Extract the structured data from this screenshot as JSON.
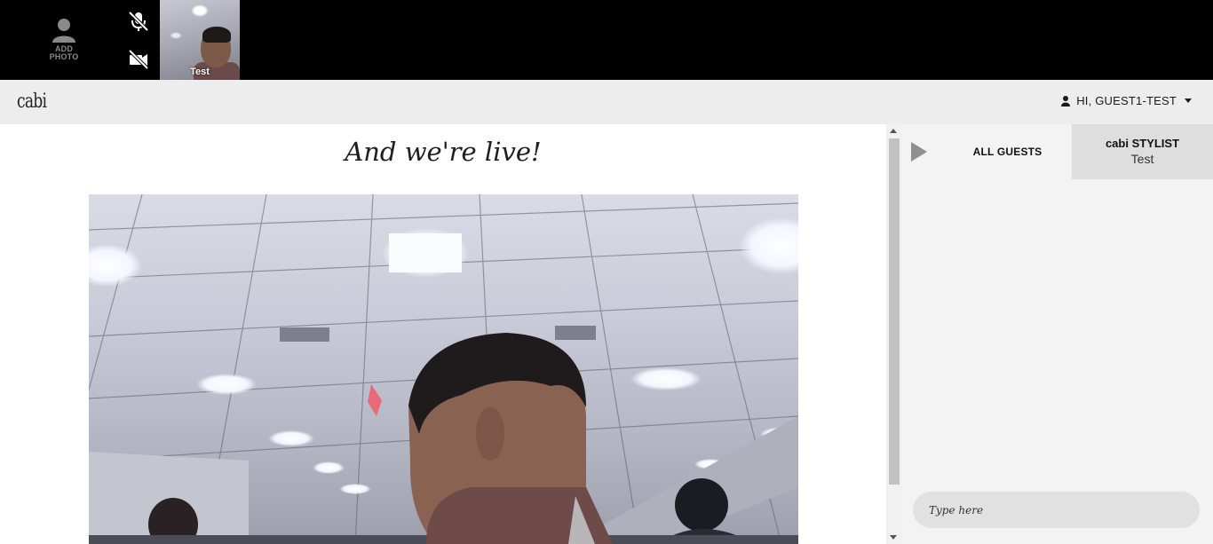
{
  "video_strip": {
    "add_photo_label": "ADD\nPHOTO",
    "mic_state": "muted",
    "camera_state": "off",
    "self_view_name": "Test"
  },
  "header": {
    "logo": "cabi",
    "user_greeting": "HI, GUEST1-TEST"
  },
  "stage": {
    "title": "And we're live!"
  },
  "chat": {
    "tabs": [
      {
        "label": "ALL GUESTS"
      },
      {
        "label": "cabi STYLIST",
        "sublabel": "Test"
      }
    ],
    "input_placeholder": "Type here"
  },
  "colors": {
    "strip_bg": "#000000",
    "header_bg": "#ededed",
    "chat_bg": "#f3f3f3",
    "active_tab_bg": "#dedede"
  }
}
